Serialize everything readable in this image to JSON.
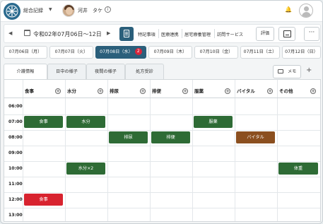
{
  "header": {
    "app_name": "総合記録",
    "user_name": "河井　タケ",
    "info_glyph": "i"
  },
  "nav": {
    "date_range": "令和02年07月06日〜12日",
    "links": [
      "特記事項",
      "医療連携",
      "居宅療養管理",
      "訪問サービス"
    ],
    "eval_label": "評価"
  },
  "days": [
    {
      "label": "07月06日（月）"
    },
    {
      "label": "07月07日（火）"
    },
    {
      "label": "07月08日（水）",
      "active": true,
      "badge": "2"
    },
    {
      "label": "07月09日（木）"
    },
    {
      "label": "07月10日（金）"
    },
    {
      "label": "07月11日（土）"
    },
    {
      "label": "07月12日（日）"
    }
  ],
  "record_tabs": [
    "介護情報",
    "日中の様子",
    "夜間の様子",
    "処方受診"
  ],
  "memo_label": "メモ",
  "columns": [
    "食事",
    "水分",
    "排尿",
    "排便",
    "服薬",
    "バイタル",
    "その他"
  ],
  "times": [
    "06:00",
    "07:00",
    "08:00",
    "09:00",
    "10:00",
    "11:00",
    "12:00",
    "13:00"
  ],
  "events": [
    {
      "label": "食事",
      "col": 0,
      "row": 1,
      "color": "#2e6b35"
    },
    {
      "label": "水分",
      "col": 1,
      "row": 1,
      "color": "#2e6b35"
    },
    {
      "label": "服薬",
      "col": 4,
      "row": 1,
      "color": "#2e6b35"
    },
    {
      "label": "排尿",
      "col": 2,
      "row": 2,
      "color": "#2e6b35"
    },
    {
      "label": "排便",
      "col": 3,
      "row": 2,
      "color": "#2e6b35"
    },
    {
      "label": "バイタル",
      "col": 5,
      "row": 2,
      "color": "#8b4f1f"
    },
    {
      "label": "水分×2",
      "col": 1,
      "row": 4,
      "color": "#2e6b35"
    },
    {
      "label": "体重",
      "col": 6,
      "row": 4,
      "color": "#2e6b35"
    },
    {
      "label": "食事",
      "col": 0,
      "row": 6,
      "color": "#d8232f"
    }
  ],
  "colors": {
    "accent": "#2b5f7b",
    "badge": "#d9263c",
    "ok": "#2e6b35",
    "vital": "#8b4f1f",
    "alert": "#d8232f"
  },
  "icons": [
    "app-logo-icon",
    "chevron-down-icon",
    "info-icon",
    "bell-icon",
    "user-profile-icon",
    "calendar-icon",
    "document-icon",
    "layout-icon",
    "more-icon",
    "memo-icon",
    "plus-icon",
    "add-circle-icon"
  ]
}
